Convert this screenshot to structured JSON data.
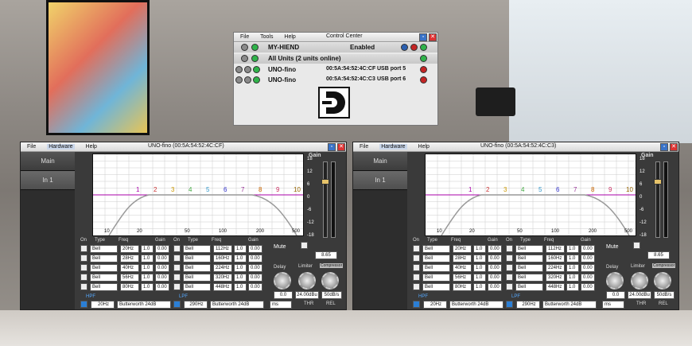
{
  "control_center": {
    "title": "Control Center",
    "menu": [
      "File",
      "Tools",
      "Help"
    ],
    "device": {
      "name": "MY-HIEND",
      "status": "Enabled"
    },
    "all_units": "All Units (2 units online)",
    "units": [
      {
        "name": "UNO-fino",
        "mac": "00:5A:54:52:4C:CF",
        "port": "USB port 5"
      },
      {
        "name": "UNO-fino",
        "mac": "00:5A:54:52:4C:C3",
        "port": "USB port 6"
      }
    ]
  },
  "uno_windows": [
    {
      "title": "UNO-fino (00:5A:54:52:4C:CF)"
    },
    {
      "title": "UNO-fino (00:5A:54:52:4C:C3)"
    }
  ],
  "uno": {
    "menu": [
      "File",
      "Hardware",
      "Help"
    ],
    "tabs": [
      "Main",
      "In 1"
    ],
    "gain_label": "Gain",
    "y_ticks": [
      "18",
      "12",
      "6",
      "0",
      "-6",
      "-12",
      "-18"
    ],
    "x_ticks": [
      "10",
      "20",
      "50",
      "100",
      "200",
      "500"
    ],
    "band_nums": [
      "1",
      "2",
      "3",
      "4",
      "5",
      "6",
      "7",
      "8",
      "9",
      "10"
    ],
    "col_headers": {
      "on": "On",
      "type": "Type",
      "freq": "Freq",
      "gain": "Gain"
    },
    "bands_left": [
      {
        "type": "Bell",
        "freq": "20Hz",
        "q": "1.0",
        "gain": "0.00"
      },
      {
        "type": "Bell",
        "freq": "28Hz",
        "q": "1.0",
        "gain": "0.00"
      },
      {
        "type": "Bell",
        "freq": "40Hz",
        "q": "1.0",
        "gain": "0.00"
      },
      {
        "type": "Bell",
        "freq": "56Hz",
        "q": "1.0",
        "gain": "0.00"
      },
      {
        "type": "Bell",
        "freq": "80Hz",
        "q": "1.0",
        "gain": "0.00"
      }
    ],
    "bands_right": [
      {
        "type": "Bell",
        "freq": "112Hz",
        "q": "1.0",
        "gain": "0.00"
      },
      {
        "type": "Bell",
        "freq": "160Hz",
        "q": "1.0",
        "gain": "0.00"
      },
      {
        "type": "Bell",
        "freq": "224Hz",
        "q": "1.0",
        "gain": "0.00"
      },
      {
        "type": "Bell",
        "freq": "320Hz",
        "q": "1.0",
        "gain": "0.00"
      },
      {
        "type": "Bell",
        "freq": "448Hz",
        "q": "1.0",
        "gain": "0.00"
      }
    ],
    "mute": "Mute",
    "gain_value": "8.65",
    "delay_label": "Delay",
    "limiter_label": "Limiter",
    "compressor_label": "Compressor",
    "delay_value": "0.0",
    "thr_value": "24.00dBu",
    "rel_value": "50dB/s",
    "delay_unit": "ms",
    "thr_label": "THR",
    "rel_label": "REL",
    "hpf": {
      "label": "HPF",
      "freq": "20Hz",
      "type": "Butterworth 24dB"
    },
    "lpf": {
      "label": "LPF",
      "freq": "290Hz",
      "type": "Butterworth 24dB"
    }
  }
}
